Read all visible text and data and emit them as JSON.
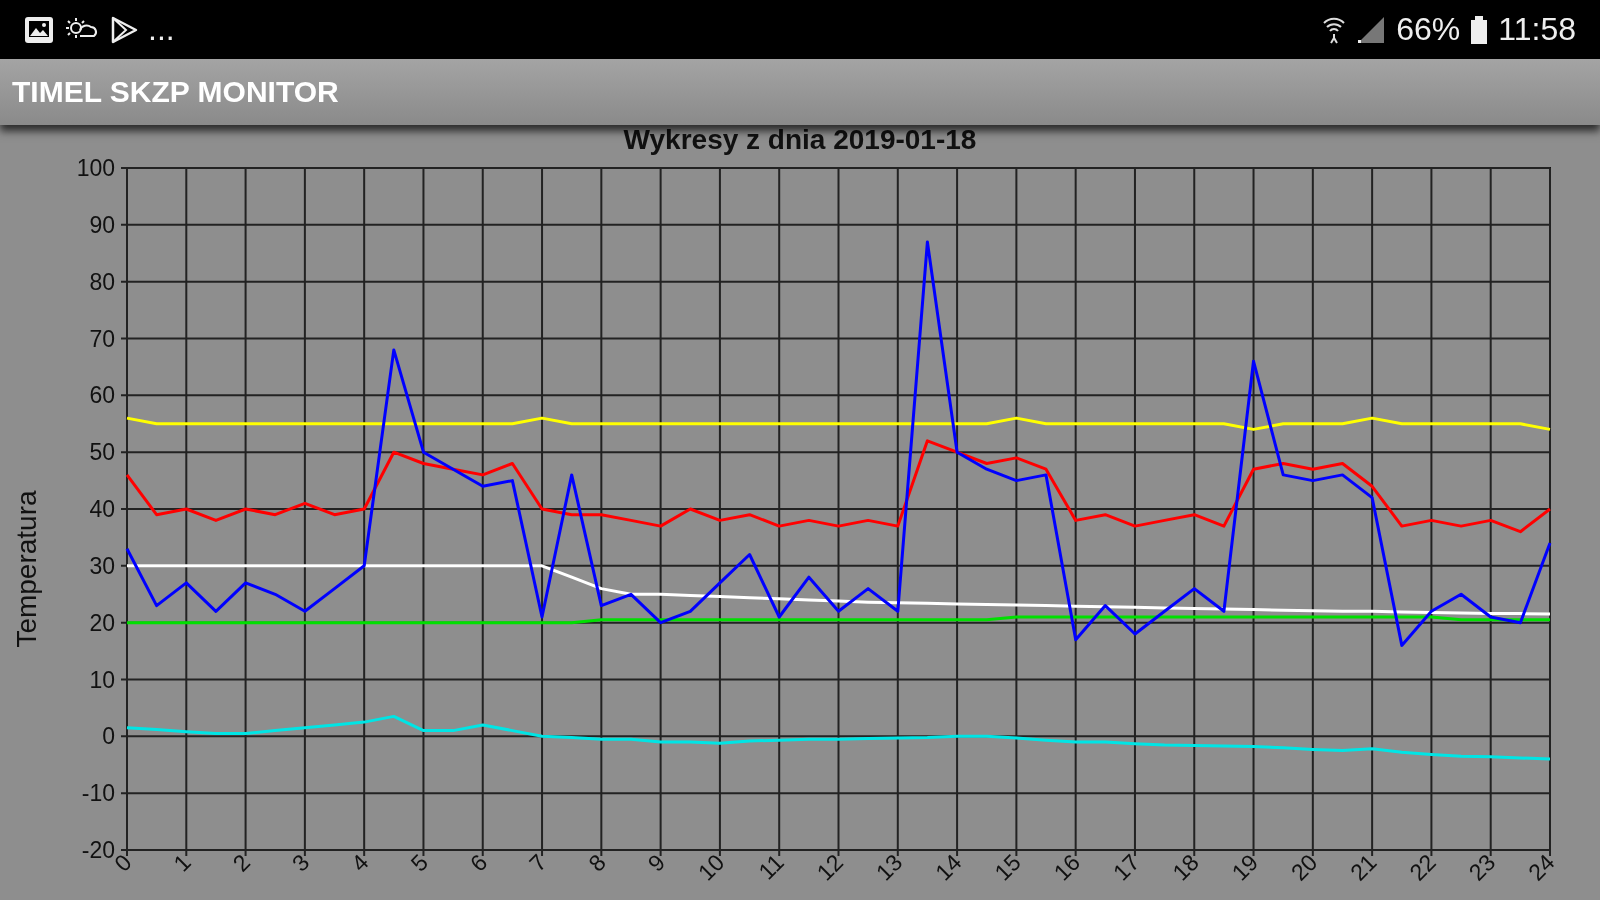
{
  "status_bar": {
    "more": "...",
    "battery": "66%",
    "time": "11:58"
  },
  "app_bar": {
    "title": "TIMEL SKZP MONITOR"
  },
  "chart": {
    "chart_data": {
      "type": "line",
      "grid": true,
      "title": "Wykresy z dnia 2019-01-18",
      "ylabel": "Temperatura",
      "x": [
        0,
        0.5,
        1,
        1.5,
        2,
        2.5,
        3,
        3.5,
        4,
        4.5,
        5,
        5.5,
        6,
        6.5,
        7,
        7.5,
        8,
        8.5,
        9,
        9.5,
        10,
        10.5,
        11,
        11.5,
        12,
        12.5,
        13,
        13.5,
        14,
        14.5,
        15,
        15.5,
        16,
        16.5,
        17,
        17.5,
        18,
        18.5,
        19,
        19.5,
        20,
        20.5,
        21,
        21.5,
        22,
        22.5,
        23,
        23.5,
        24
      ],
      "xlim": [
        0,
        24
      ],
      "ylim": [
        -20,
        100
      ],
      "xticks": [
        0,
        1,
        2,
        3,
        4,
        5,
        6,
        7,
        8,
        9,
        10,
        11,
        12,
        13,
        14,
        15,
        16,
        17,
        18,
        19,
        20,
        21,
        22,
        23,
        24
      ],
      "yticks": [
        -20,
        -10,
        0,
        10,
        20,
        30,
        40,
        50,
        60,
        70,
        80,
        90,
        100
      ],
      "series": [
        {
          "color": "#ffff00",
          "values": [
            56,
            55,
            55,
            55,
            55,
            55,
            55,
            55,
            55,
            55,
            55,
            55,
            55,
            55,
            56,
            55,
            55,
            55,
            55,
            55,
            55,
            55,
            55,
            55,
            55,
            55,
            55,
            55,
            55,
            55,
            56,
            55,
            55,
            55,
            55,
            55,
            55,
            55,
            54,
            55,
            55,
            55,
            56,
            55,
            55,
            55,
            55,
            55,
            54
          ]
        },
        {
          "color": "#ff0000",
          "values": [
            46,
            39,
            40,
            38,
            40,
            39,
            41,
            39,
            40,
            50,
            48,
            47,
            46,
            48,
            40,
            39,
            39,
            38,
            37,
            40,
            38,
            39,
            37,
            38,
            37,
            38,
            37,
            52,
            50,
            48,
            49,
            47,
            38,
            39,
            37,
            38,
            39,
            37,
            47,
            48,
            47,
            48,
            44,
            37,
            38,
            37,
            38,
            36,
            40
          ]
        },
        {
          "color": "#ffffff",
          "values": [
            30,
            30,
            30,
            30,
            30,
            30,
            30,
            30,
            30,
            30,
            30,
            30,
            30,
            30,
            30,
            28,
            26,
            25,
            25,
            24.8,
            24.6,
            24.4,
            24.2,
            24,
            23.8,
            23.6,
            23.5,
            23.4,
            23.3,
            23.2,
            23.1,
            23,
            22.9,
            22.8,
            22.7,
            22.6,
            22.5,
            22.4,
            22.3,
            22.2,
            22.1,
            22,
            22,
            21.9,
            21.8,
            21.7,
            21.6,
            21.6,
            21.5
          ]
        },
        {
          "color": "#00e000",
          "values": [
            20,
            20,
            20,
            20,
            20,
            20,
            20,
            20,
            20,
            20,
            20,
            20,
            20,
            20,
            20,
            20,
            20.5,
            20.5,
            20.5,
            20.5,
            20.5,
            20.5,
            20.5,
            20.5,
            20.5,
            20.5,
            20.5,
            20.5,
            20.5,
            20.5,
            21,
            21,
            21,
            21,
            21,
            21,
            21,
            21,
            21,
            21,
            21,
            21,
            21,
            21,
            21,
            20.5,
            20.5,
            20.5,
            20.5
          ]
        },
        {
          "color": "#0000ff",
          "values": [
            33,
            23,
            27,
            22,
            27,
            25,
            22,
            26,
            30,
            68,
            50,
            47,
            44,
            45,
            21,
            46,
            23,
            25,
            20,
            22,
            27,
            32,
            21,
            28,
            22,
            26,
            22,
            87,
            50,
            47,
            45,
            46,
            17,
            23,
            18,
            22,
            26,
            22,
            66,
            46,
            45,
            46,
            42,
            16,
            22,
            25,
            21,
            20,
            34
          ]
        },
        {
          "color": "#00e5e5",
          "values": [
            1.5,
            1.2,
            0.8,
            0.5,
            0.5,
            1,
            1.5,
            2,
            2.5,
            3.5,
            1,
            1,
            2,
            1,
            0,
            -0.2,
            -0.5,
            -0.5,
            -1,
            -1,
            -1.2,
            -0.8,
            -0.7,
            -0.5,
            -0.5,
            -0.4,
            -0.3,
            -0.2,
            0,
            0,
            -0.3,
            -0.7,
            -1,
            -1,
            -1.3,
            -1.5,
            -1.6,
            -1.7,
            -1.8,
            -2,
            -2.3,
            -2.5,
            -2.2,
            -2.8,
            -3.2,
            -3.5,
            -3.6,
            -3.8,
            -4
          ]
        }
      ]
    }
  }
}
